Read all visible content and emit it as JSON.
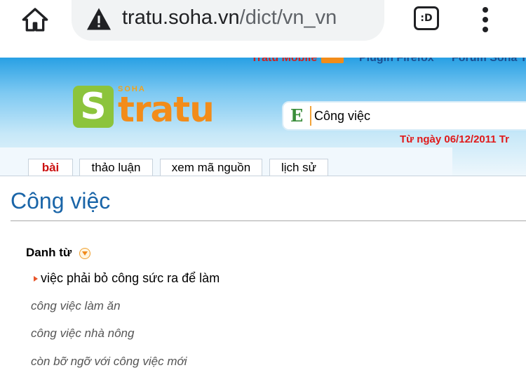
{
  "browser": {
    "url_domain": "tratu.soha.vn",
    "url_path": "/dict/vn_vn",
    "tab_switch_label": ":D"
  },
  "header": {
    "toplinks": {
      "mobile": "Tratu Mobile",
      "plugin": "Plugin Firefox",
      "forum": "Forum Soha T"
    },
    "logo": {
      "soha": "SOHA",
      "s": "S",
      "text": "tratu"
    },
    "search_value": "Công việc",
    "search_prefix": "E",
    "notice": "Từ ngày 06/12/2011 Tr"
  },
  "tabs": [
    {
      "label": "bài"
    },
    {
      "label": "thảo luận"
    },
    {
      "label": "xem mã nguồn"
    },
    {
      "label": "lịch sử"
    }
  ],
  "entry": {
    "title": "Công việc",
    "part_of_speech": "Danh từ",
    "definition": "việc phải bỏ công sức ra để làm",
    "examples": [
      "công việc làm ăn",
      "công việc nhà nông",
      "còn bỡ ngỡ với công việc mới"
    ]
  },
  "colors": {
    "accent_link": "#1a65a8",
    "active_tab": "#c11111",
    "notice": "#e01a1a",
    "logo_green": "#8cc43c",
    "logo_orange": "#f28c1a"
  }
}
